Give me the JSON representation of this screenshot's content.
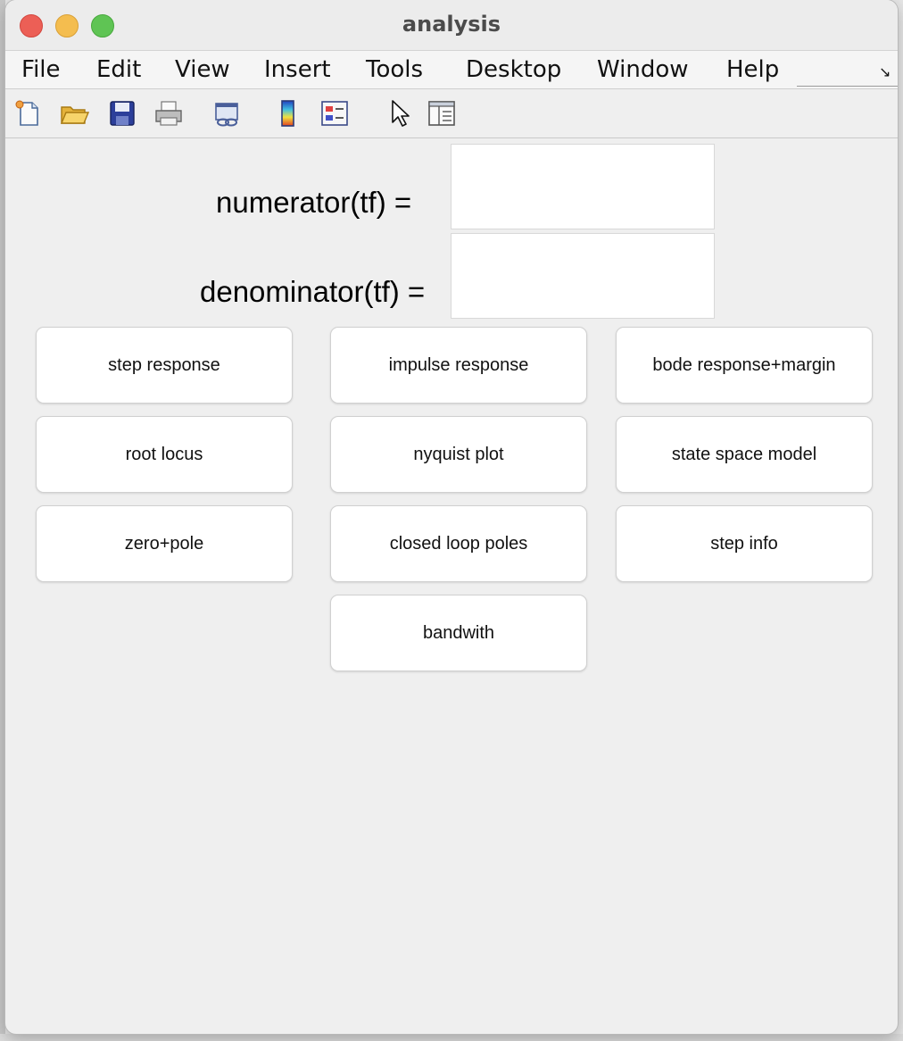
{
  "window": {
    "title": "analysis"
  },
  "menu": [
    "File",
    "Edit",
    "View",
    "Insert",
    "Tools",
    "Desktop",
    "Window",
    "Help"
  ],
  "toolbar": [
    "new-figure-icon",
    "open-file-icon",
    "save-icon",
    "print-icon",
    "link-plot-icon",
    "colorbar-icon",
    "legend-icon",
    "pointer-icon",
    "property-editor-icon"
  ],
  "form": {
    "numerator_label": "numerator(tf) =",
    "numerator_value": "",
    "denominator_label": "denominator(tf) =",
    "denominator_value": ""
  },
  "buttons": {
    "step_response": "step response",
    "impulse_response": "impulse response",
    "bode_response_margin": "bode response+margin",
    "root_locus": "root locus",
    "nyquist_plot": "nyquist plot",
    "state_space_model": "state space model",
    "zero_pole": "zero+pole",
    "closed_loop_poles": "closed loop poles",
    "step_info": "step info",
    "bandwith": "bandwith"
  }
}
